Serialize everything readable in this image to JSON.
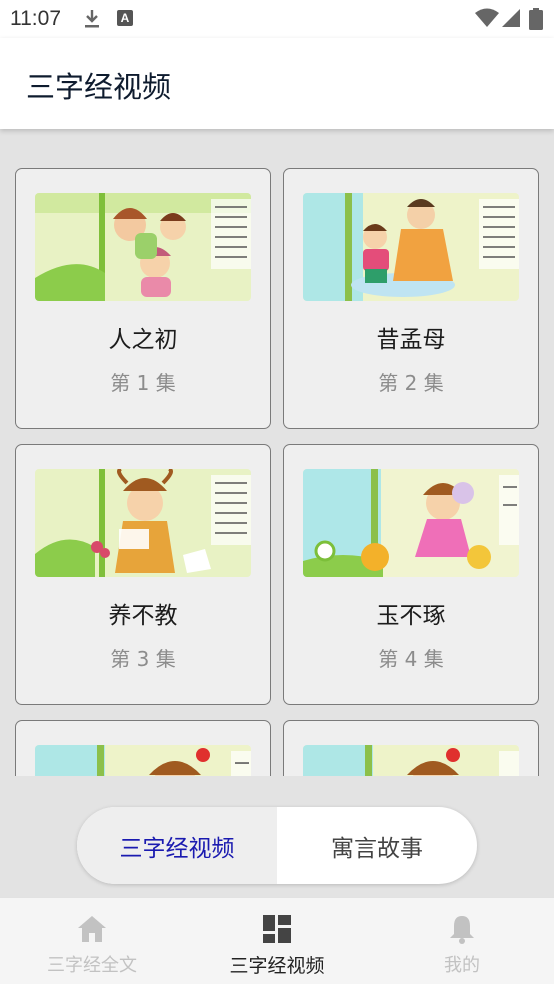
{
  "status_bar": {
    "time": "11:07",
    "icons": [
      "download-icon",
      "a-notification-icon",
      "wifi-icon",
      "signal-icon",
      "battery-icon"
    ]
  },
  "app_bar": {
    "title": "三字经视频"
  },
  "episodes": [
    {
      "title": "人之初",
      "episode": "第 1 集"
    },
    {
      "title": "昔孟母",
      "episode": "第 2 集"
    },
    {
      "title": "养不教",
      "episode": "第 3 集"
    },
    {
      "title": "玉不琢",
      "episode": "第 4 集"
    },
    {
      "title": "",
      "episode": ""
    },
    {
      "title": "",
      "episode": ""
    }
  ],
  "segmented_control": {
    "left_label": "三字经视频",
    "right_label": "寓言故事",
    "selected": "left"
  },
  "bottom_nav": {
    "items": [
      {
        "label": "三字经全文",
        "icon": "home-icon",
        "active": false
      },
      {
        "label": "三字经视频",
        "icon": "dashboard-icon",
        "active": true
      },
      {
        "label": "我的",
        "icon": "bell-icon",
        "active": false
      }
    ]
  },
  "colors": {
    "accent": "#1a1ab0",
    "content_bg": "#e3e3e3",
    "card_bg": "#efefef",
    "inactive_nav": "#c2c2c2"
  }
}
